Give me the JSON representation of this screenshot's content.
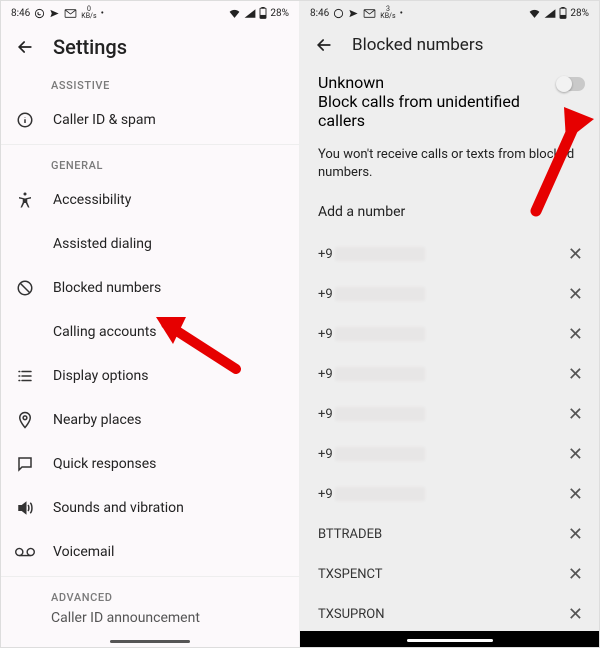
{
  "status": {
    "time": "8:46",
    "kbps3": "3",
    "kbpsUnit": "KB/s",
    "kbps0": "0",
    "batt": "28%"
  },
  "left": {
    "title": "Settings",
    "sections": {
      "assistive": "ASSISTIVE",
      "general": "GENERAL",
      "advanced": "ADVANCED"
    },
    "items": {
      "callerIdSpam": "Caller ID & spam",
      "accessibility": "Accessibility",
      "assistedDialing": "Assisted dialing",
      "blockedNumbers": "Blocked numbers",
      "callingAccounts": "Calling accounts",
      "displayOptions": "Display options",
      "nearbyPlaces": "Nearby places",
      "quickResponses": "Quick responses",
      "soundsVibration": "Sounds and vibration",
      "voicemail": "Voicemail",
      "callerIdAnnounce": "Caller ID announcement"
    }
  },
  "right": {
    "title": "Blocked numbers",
    "unknownTitle": "Unknown",
    "unknownSub": "Block calls from unidentified callers",
    "info": "You won't receive calls or texts from blocked numbers.",
    "add": "Add a number",
    "numPrefix": "+9",
    "names": {
      "n1": "BTTRADEB",
      "n2": "TXSPENCT",
      "n3": "TXSUPRON"
    }
  }
}
